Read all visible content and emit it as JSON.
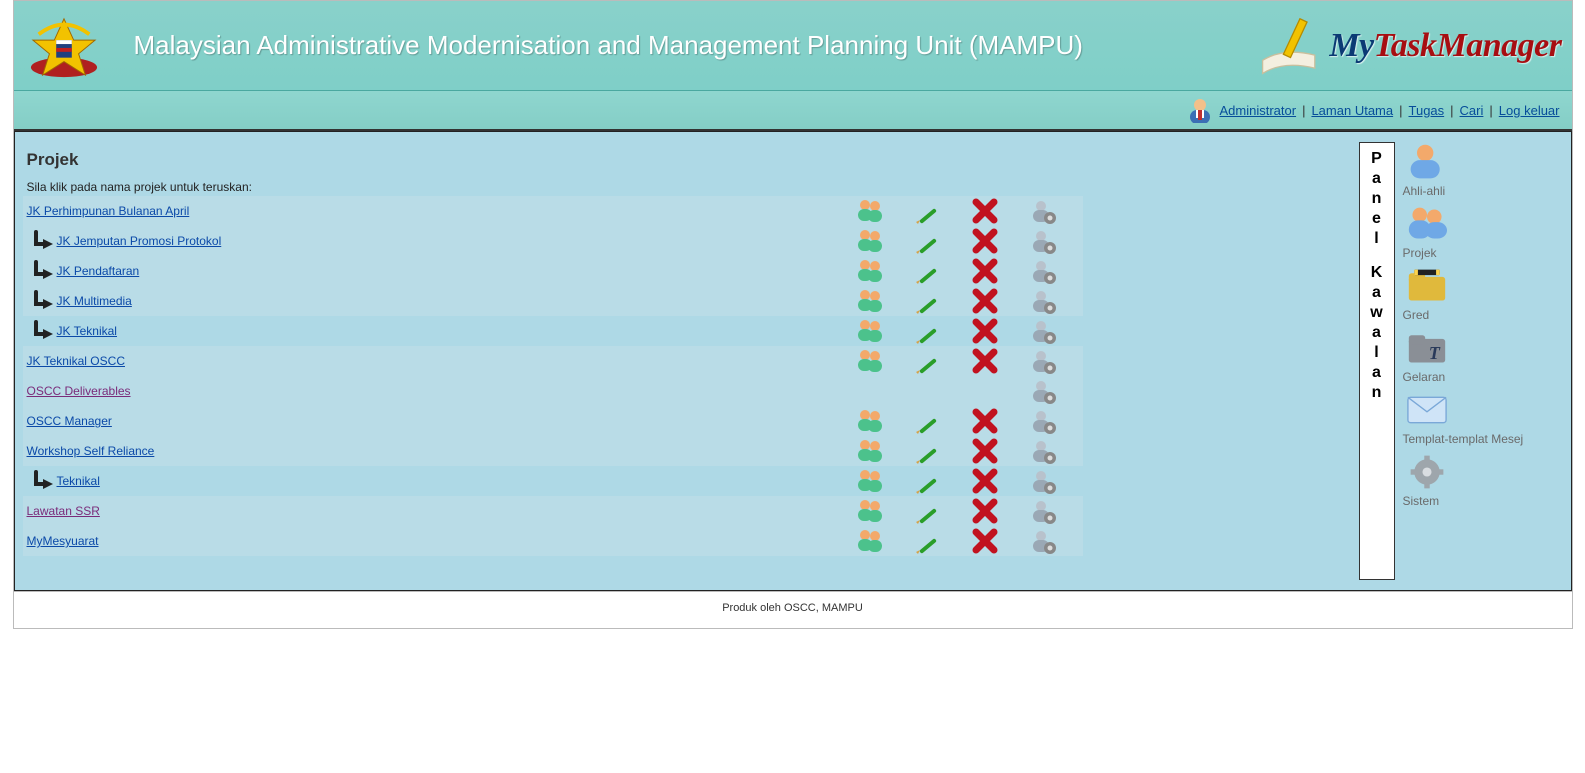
{
  "header": {
    "title": "Malaysian Administrative Modernisation and Management Planning Unit (MAMPU)",
    "app_name_blue": "My",
    "app_name_red": "TaskManager"
  },
  "subnav": {
    "user": "Administrator",
    "home": "Laman Utama",
    "tasks": "Tugas",
    "search": "Cari",
    "logout": "Log keluar"
  },
  "main": {
    "section_title": "Projek",
    "instruction": "Sila klik pada nama projek untuk teruskan:"
  },
  "projects": [
    {
      "name": "JK Perhimpunan Bulanan April",
      "child": false,
      "visited": false,
      "shade": true,
      "users": true,
      "edit": true,
      "delete": true,
      "settings": true
    },
    {
      "name": "JK Jemputan Promosi Protokol",
      "child": true,
      "visited": false,
      "shade": true,
      "users": true,
      "edit": true,
      "delete": true,
      "settings": true
    },
    {
      "name": "JK Pendaftaran",
      "child": true,
      "visited": false,
      "shade": true,
      "users": true,
      "edit": true,
      "delete": true,
      "settings": true
    },
    {
      "name": "JK Multimedia",
      "child": true,
      "visited": false,
      "shade": true,
      "users": true,
      "edit": true,
      "delete": true,
      "settings": true
    },
    {
      "name": "JK Teknikal",
      "child": true,
      "visited": false,
      "shade": false,
      "users": true,
      "edit": true,
      "delete": true,
      "settings": true
    },
    {
      "name": "JK Teknikal OSCC",
      "child": false,
      "visited": false,
      "shade": true,
      "users": true,
      "edit": true,
      "delete": true,
      "settings": true
    },
    {
      "name": "OSCC Deliverables",
      "child": false,
      "visited": true,
      "shade": true,
      "users": false,
      "edit": false,
      "delete": false,
      "settings": true
    },
    {
      "name": "OSCC Manager",
      "child": false,
      "visited": false,
      "shade": true,
      "users": true,
      "edit": true,
      "delete": true,
      "settings": true
    },
    {
      "name": "Workshop Self Reliance",
      "child": false,
      "visited": false,
      "shade": true,
      "users": true,
      "edit": true,
      "delete": true,
      "settings": true
    },
    {
      "name": "Teknikal",
      "child": true,
      "visited": false,
      "shade": false,
      "users": true,
      "edit": true,
      "delete": true,
      "settings": true
    },
    {
      "name": "Lawatan SSR",
      "child": false,
      "visited": true,
      "shade": true,
      "users": true,
      "edit": true,
      "delete": true,
      "settings": true
    },
    {
      "name": "MyMesyuarat",
      "child": false,
      "visited": false,
      "shade": true,
      "users": true,
      "edit": true,
      "delete": true,
      "settings": true
    }
  ],
  "control_bar": {
    "label": "Panel Kawalan"
  },
  "side_panel": [
    {
      "key": "members",
      "label": "Ahli-ahli"
    },
    {
      "key": "projects",
      "label": "Projek"
    },
    {
      "key": "grades",
      "label": "Gred"
    },
    {
      "key": "titles",
      "label": "Gelaran"
    },
    {
      "key": "msgtpl",
      "label": "Templat-templat Mesej"
    },
    {
      "key": "system",
      "label": "Sistem"
    }
  ],
  "footer": {
    "text": "Produk oleh OSCC, MAMPU"
  }
}
